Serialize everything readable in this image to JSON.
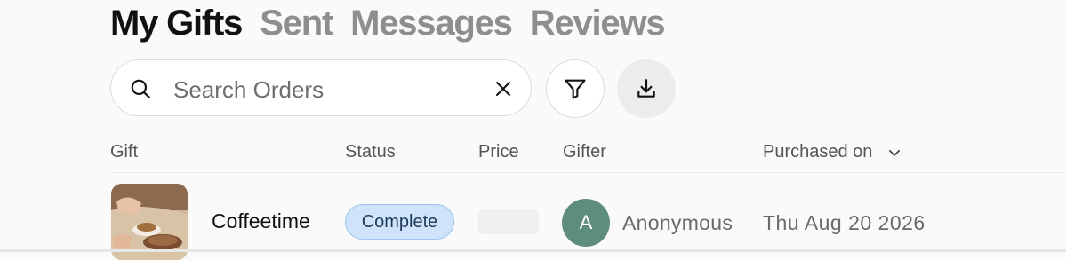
{
  "tabs": [
    {
      "label": "My Gifts",
      "active": true
    },
    {
      "label": "Sent",
      "active": false
    },
    {
      "label": "Messages",
      "active": false
    },
    {
      "label": "Reviews",
      "active": false
    }
  ],
  "search": {
    "placeholder": "Search Orders",
    "value": ""
  },
  "icons": {
    "search": "search-icon",
    "clear": "close-icon",
    "filter": "filter-icon",
    "download": "download-icon",
    "sort": "chevron-down-icon"
  },
  "table": {
    "columns": [
      "Gift",
      "Status",
      "Price",
      "Gifter",
      "Purchased on"
    ],
    "rows": [
      {
        "gift": "Coffeetime",
        "status": "Complete",
        "price": "",
        "gifter_initial": "A",
        "gifter": "Anonymous",
        "purchased_on": "Thu Aug 20 2026"
      }
    ]
  },
  "colors": {
    "status_complete_bg": "#cfe4fb",
    "status_complete_border": "#9cc4ee",
    "avatar": "#5f8d7c"
  }
}
